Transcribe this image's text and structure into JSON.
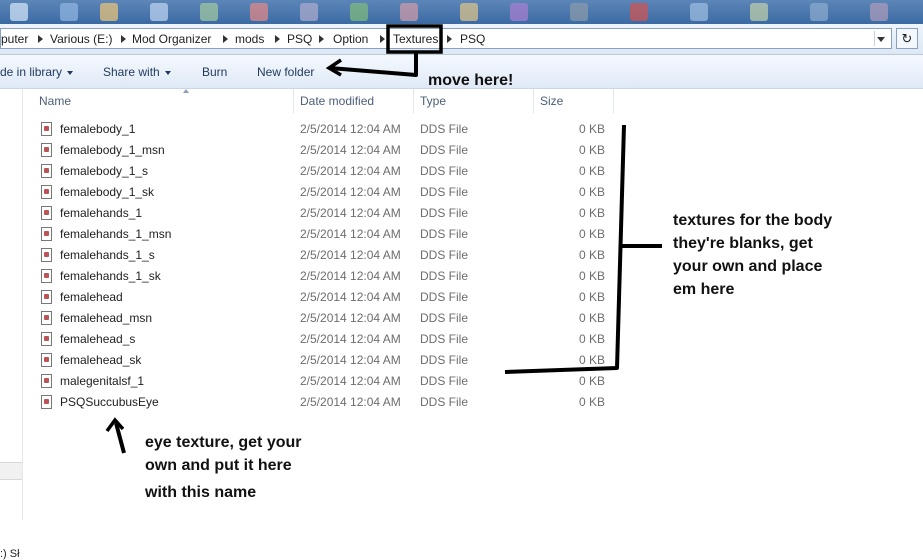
{
  "breadcrumb": [
    "puter",
    "Various (E:)",
    "Mod Organizer",
    "mods",
    "PSQ",
    "Option",
    "Textures",
    "PSQ"
  ],
  "toolbar": {
    "include_label": "de in library",
    "share_label": "Share with",
    "burn_label": "Burn",
    "newfolder_label": "New folder"
  },
  "columns": {
    "name": "Name",
    "date": "Date modified",
    "type": "Type",
    "size": "Size"
  },
  "files": [
    {
      "name": "femalebody_1",
      "date": "2/5/2014 12:04 AM",
      "type": "DDS File",
      "size": "0 KB"
    },
    {
      "name": "femalebody_1_msn",
      "date": "2/5/2014 12:04 AM",
      "type": "DDS File",
      "size": "0 KB"
    },
    {
      "name": "femalebody_1_s",
      "date": "2/5/2014 12:04 AM",
      "type": "DDS File",
      "size": "0 KB"
    },
    {
      "name": "femalebody_1_sk",
      "date": "2/5/2014 12:04 AM",
      "type": "DDS File",
      "size": "0 KB"
    },
    {
      "name": "femalehands_1",
      "date": "2/5/2014 12:04 AM",
      "type": "DDS File",
      "size": "0 KB"
    },
    {
      "name": "femalehands_1_msn",
      "date": "2/5/2014 12:04 AM",
      "type": "DDS File",
      "size": "0 KB"
    },
    {
      "name": "femalehands_1_s",
      "date": "2/5/2014 12:04 AM",
      "type": "DDS File",
      "size": "0 KB"
    },
    {
      "name": "femalehands_1_sk",
      "date": "2/5/2014 12:04 AM",
      "type": "DDS File",
      "size": "0 KB"
    },
    {
      "name": "femalehead",
      "date": "2/5/2014 12:04 AM",
      "type": "DDS File",
      "size": "0 KB"
    },
    {
      "name": "femalehead_msn",
      "date": "2/5/2014 12:04 AM",
      "type": "DDS File",
      "size": "0 KB"
    },
    {
      "name": "femalehead_s",
      "date": "2/5/2014 12:04 AM",
      "type": "DDS File",
      "size": "0 KB"
    },
    {
      "name": "femalehead_sk",
      "date": "2/5/2014 12:04 AM",
      "type": "DDS File",
      "size": "0 KB"
    },
    {
      "name": "malegenitalsf_1",
      "date": "2/5/2014 12:04 AM",
      "type": "DDS File",
      "size": "0 KB"
    },
    {
      "name": "PSQSuccubusEye",
      "date": "2/5/2014 12:04 AM",
      "type": "DDS File",
      "size": "0 KB"
    }
  ],
  "left_pane": {
    "drive_label": ":) Sł"
  },
  "annotations": {
    "move_here": "move here!",
    "textures_note": [
      "textures for the body",
      "they're blanks, get",
      "your own and place",
      "em here"
    ],
    "eye_note": [
      "eye texture, get your",
      "own and put it here",
      "with this name"
    ]
  },
  "colors": {
    "highlight_box": "#000000",
    "toolbar_text": "#1e395b",
    "header_text": "#4c607a"
  }
}
